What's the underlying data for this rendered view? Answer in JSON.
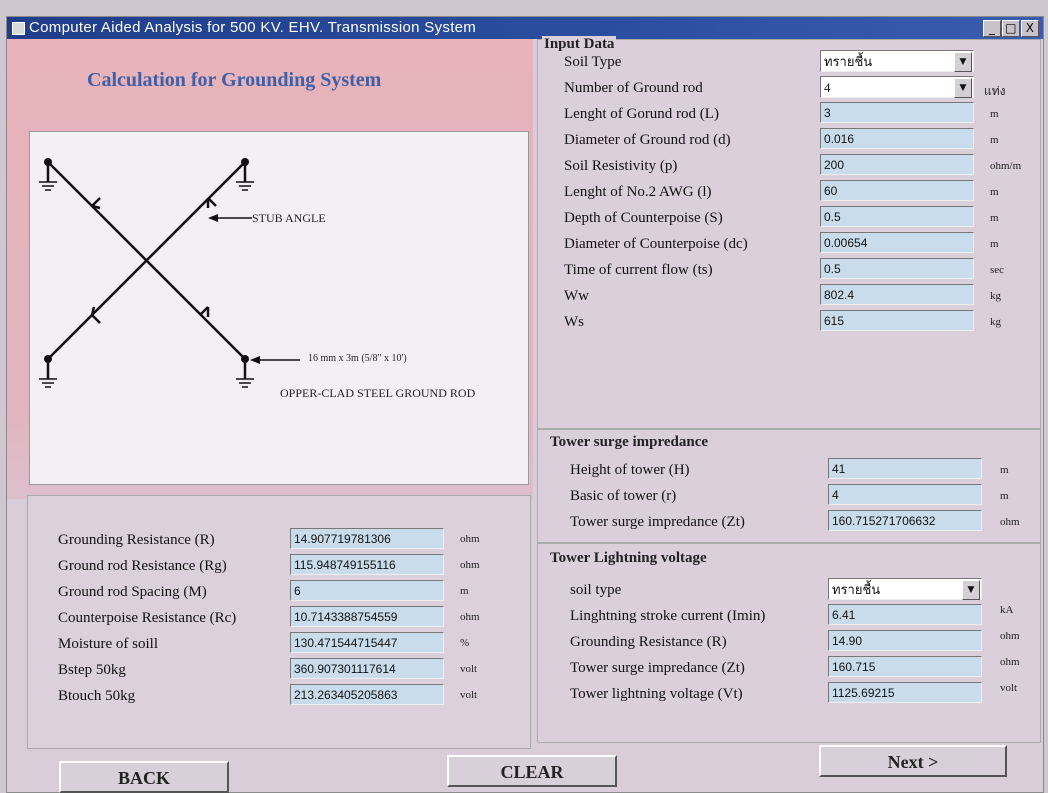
{
  "window": {
    "title": "Computer Aided Analysis for 500 KV. EHV. Transmission System",
    "minimize": "_",
    "maximize": "□",
    "close": "X"
  },
  "left": {
    "title": "Calculation for Grounding System",
    "diagram": {
      "stub_label": "STUB ANGLE",
      "rod_size_label": "16 mm x 3m (5/8\" x 10')",
      "rod_type_label": "OPPER-CLAD STEEL GROUND ROD"
    },
    "results": [
      {
        "label": "Grounding Resistance (R)",
        "value": "14.907719781306",
        "unit": "ohm"
      },
      {
        "label": "Ground rod Resistance (Rg)",
        "value": "115.948749155116",
        "unit": "ohm"
      },
      {
        "label": "Ground rod Spacing (M)",
        "value": "6",
        "unit": "m"
      },
      {
        "label": "Counterpoise Resistance (Rc)",
        "value": "10.7143388754559",
        "unit": "ohm"
      },
      {
        "label": "Moisture of soill",
        "value": "130.471544715447",
        "unit": "%"
      },
      {
        "label": "Bstep 50kg",
        "value": "360.907301117614",
        "unit": "volt"
      },
      {
        "label": "Btouch 50kg",
        "value": "213.263405205863",
        "unit": "volt"
      }
    ]
  },
  "input": {
    "title": "Input Data",
    "soil_type": {
      "label": "Soil Type",
      "value": "ทรายชื้น"
    },
    "num_rods": {
      "label": "Number of Ground rod",
      "value": "4",
      "unit": "แท่ง"
    },
    "fields": [
      {
        "label": "Lenght of Gorund rod (L)",
        "value": "3",
        "unit": "m"
      },
      {
        "label": "Diameter of Ground rod (d)",
        "value": "0.016",
        "unit": "m"
      },
      {
        "label": "Soil Resistivity (p)",
        "value": "200",
        "unit": "ohm/m"
      },
      {
        "label": "Lenght of No.2 AWG (l)",
        "value": "60",
        "unit": "m"
      },
      {
        "label": "Depth of Counterpoise (S)",
        "value": "0.5",
        "unit": "m"
      },
      {
        "label": "Diameter of Counterpoise (dc)",
        "value": "0.00654",
        "unit": "m"
      },
      {
        "label": "Time of current flow (ts)",
        "value": "0.5",
        "unit": "sec"
      },
      {
        "label": "Ww",
        "value": "802.4",
        "unit": "kg"
      },
      {
        "label": "Ws",
        "value": "615",
        "unit": "kg"
      }
    ]
  },
  "surge": {
    "title": "Tower surge impredance",
    "fields": [
      {
        "label": "Height of tower (H)",
        "value": "41",
        "unit": "m"
      },
      {
        "label": "Basic of tower (r)",
        "value": "4",
        "unit": "m"
      },
      {
        "label": "Tower surge impredance (Zt)",
        "value": "160.715271706632",
        "unit": "ohm"
      }
    ]
  },
  "lightning": {
    "title": "Tower Lightning voltage",
    "soil_type": {
      "label": "soil type",
      "value": "ทรายชื้น"
    },
    "fields": [
      {
        "label": "Linghtning stroke current (Imin)",
        "value": "6.41",
        "unit": "kA"
      },
      {
        "label": "Grounding Resistance (R)",
        "value": "14.90",
        "unit": "ohm"
      },
      {
        "label": "Tower surge impredance (Zt)",
        "value": "160.715",
        "unit": "ohm"
      },
      {
        "label": "Tower lightning voltage (Vt)",
        "value": "1125.69215",
        "unit": "volt"
      }
    ]
  },
  "buttons": {
    "back": "BACK",
    "clear": "CLEAR",
    "next": "Next >"
  }
}
